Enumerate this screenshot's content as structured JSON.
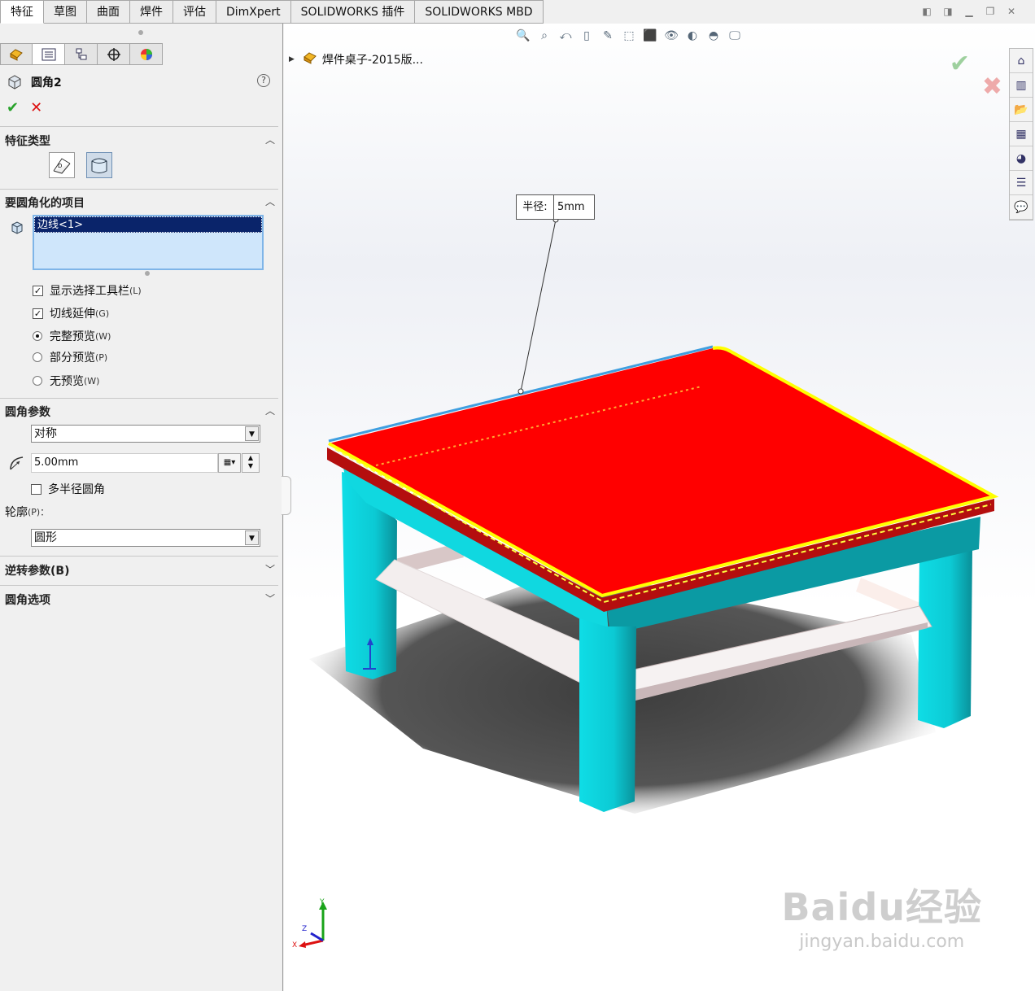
{
  "command_tabs": [
    "特征",
    "草图",
    "曲面",
    "焊件",
    "评估",
    "DimXpert",
    "SOLIDWORKS 插件",
    "SOLIDWORKS MBD"
  ],
  "property_manager": {
    "title": "圆角2",
    "help": "?",
    "sections": {
      "feature_type": "特征类型",
      "items_to_fillet": "要圆角化的项目",
      "fillet_params": "圆角参数",
      "reverse_params": "逆转参数(B)",
      "fillet_options": "圆角选项"
    },
    "selected_items": [
      "边线<1>"
    ],
    "options": {
      "show_toolbar": {
        "label": "显示选择工具栏",
        "key": "(L)",
        "checked": true
      },
      "tangent_prop": {
        "label": "切线延伸",
        "key": "(G)",
        "checked": true
      },
      "full_preview": {
        "label": "完整预览",
        "key": "(W)",
        "selected": true
      },
      "partial_preview": {
        "label": "部分预览",
        "key": "(P)",
        "selected": false
      },
      "no_preview": {
        "label": "无预览",
        "key": "(W)",
        "selected": false
      }
    },
    "fillet_method": "对称",
    "radius_value": "5.00mm",
    "multi_radius": {
      "label": "多半径圆角",
      "checked": false
    },
    "profile_label": "轮廓",
    "profile_key": "(P)：",
    "profile_value": "圆形"
  },
  "viewport": {
    "tree_root": "焊件桌子-2015版...",
    "callout": {
      "label": "半径:",
      "value": "5mm"
    }
  },
  "colors": {
    "top_face": "#ff0000",
    "frame": "#00e0e8",
    "highlight_edge": "#ffff00",
    "stretcher": "#f4f0f0"
  },
  "watermark": {
    "brand": "Baidu经验",
    "url": "jingyan.baidu.com"
  }
}
